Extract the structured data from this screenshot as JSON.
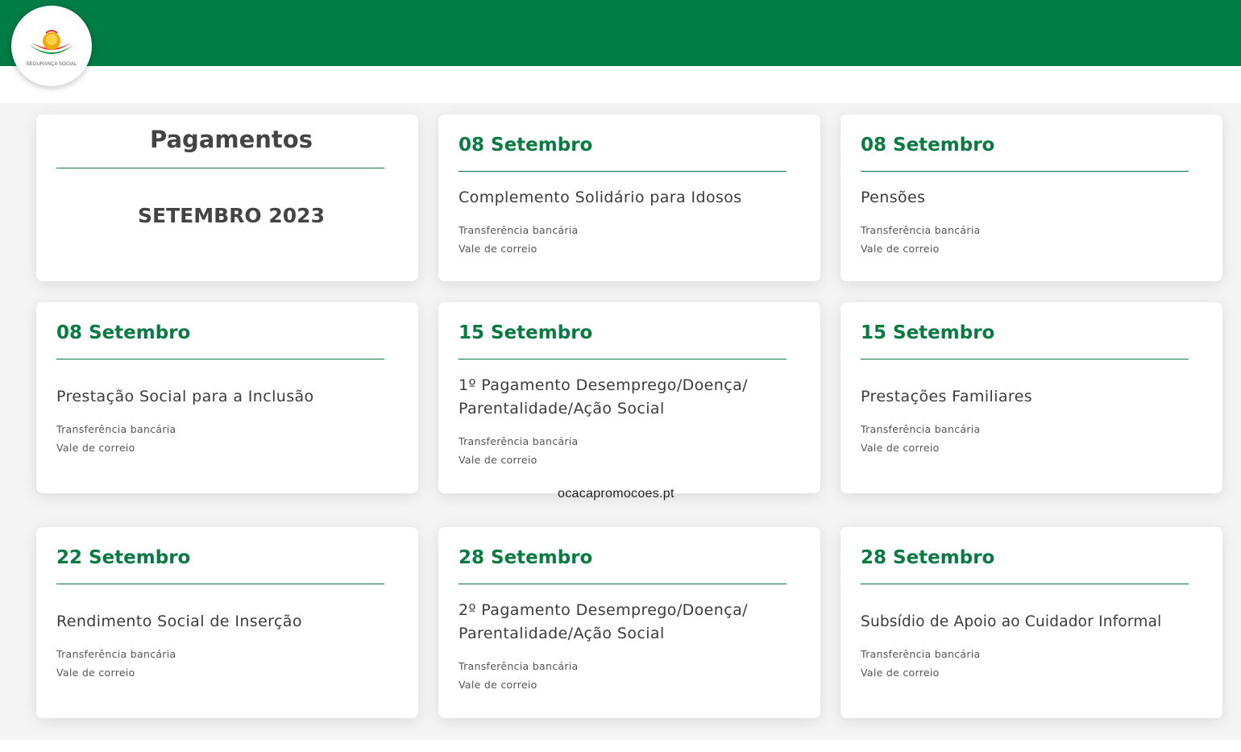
{
  "brand": {
    "logo_text": "SEGURANÇA SOCIAL",
    "header_color": "#007c45",
    "accent_color": "#0a7a43"
  },
  "intro": {
    "title": "Pagamentos",
    "month": "SETEMBRO 2023"
  },
  "cards": [
    {
      "date": "08 Setembro",
      "title": "Complemento Solidário para Idosos",
      "methods": [
        "Transferência bancária",
        "Vale de correio"
      ]
    },
    {
      "date": "08 Setembro",
      "title": "Pensões",
      "methods": [
        "Transferência bancária",
        "Vale de correio"
      ]
    },
    {
      "date": "08 Setembro",
      "title": "Prestação Social para a Inclusão",
      "methods": [
        "Transferência bancária",
        "Vale de correio"
      ]
    },
    {
      "date": "15 Setembro",
      "title": "1º Pagamento Desemprego/Doença/ Parentalidade/Ação Social",
      "methods": [
        "Transferência bancária",
        "Vale de correio"
      ]
    },
    {
      "date": "15 Setembro",
      "title": "Prestações Familiares",
      "methods": [
        "Transferência bancária",
        "Vale de correio"
      ]
    },
    {
      "date": "22 Setembro",
      "title": "Rendimento Social de Inserção",
      "methods": [
        "Transferência bancária",
        "Vale de correio"
      ]
    },
    {
      "date": "28 Setembro",
      "title": "2º Pagamento Desemprego/Doença/ Parentalidade/Ação Social",
      "methods": [
        "Transferência bancária",
        "Vale de correio"
      ]
    },
    {
      "date": "28 Setembro",
      "title": "Subsídio de Apoio ao Cuidador Informal",
      "methods": [
        "Transferência bancária",
        "Vale de correio"
      ]
    }
  ],
  "watermark": "ocacapromocoes.pt"
}
